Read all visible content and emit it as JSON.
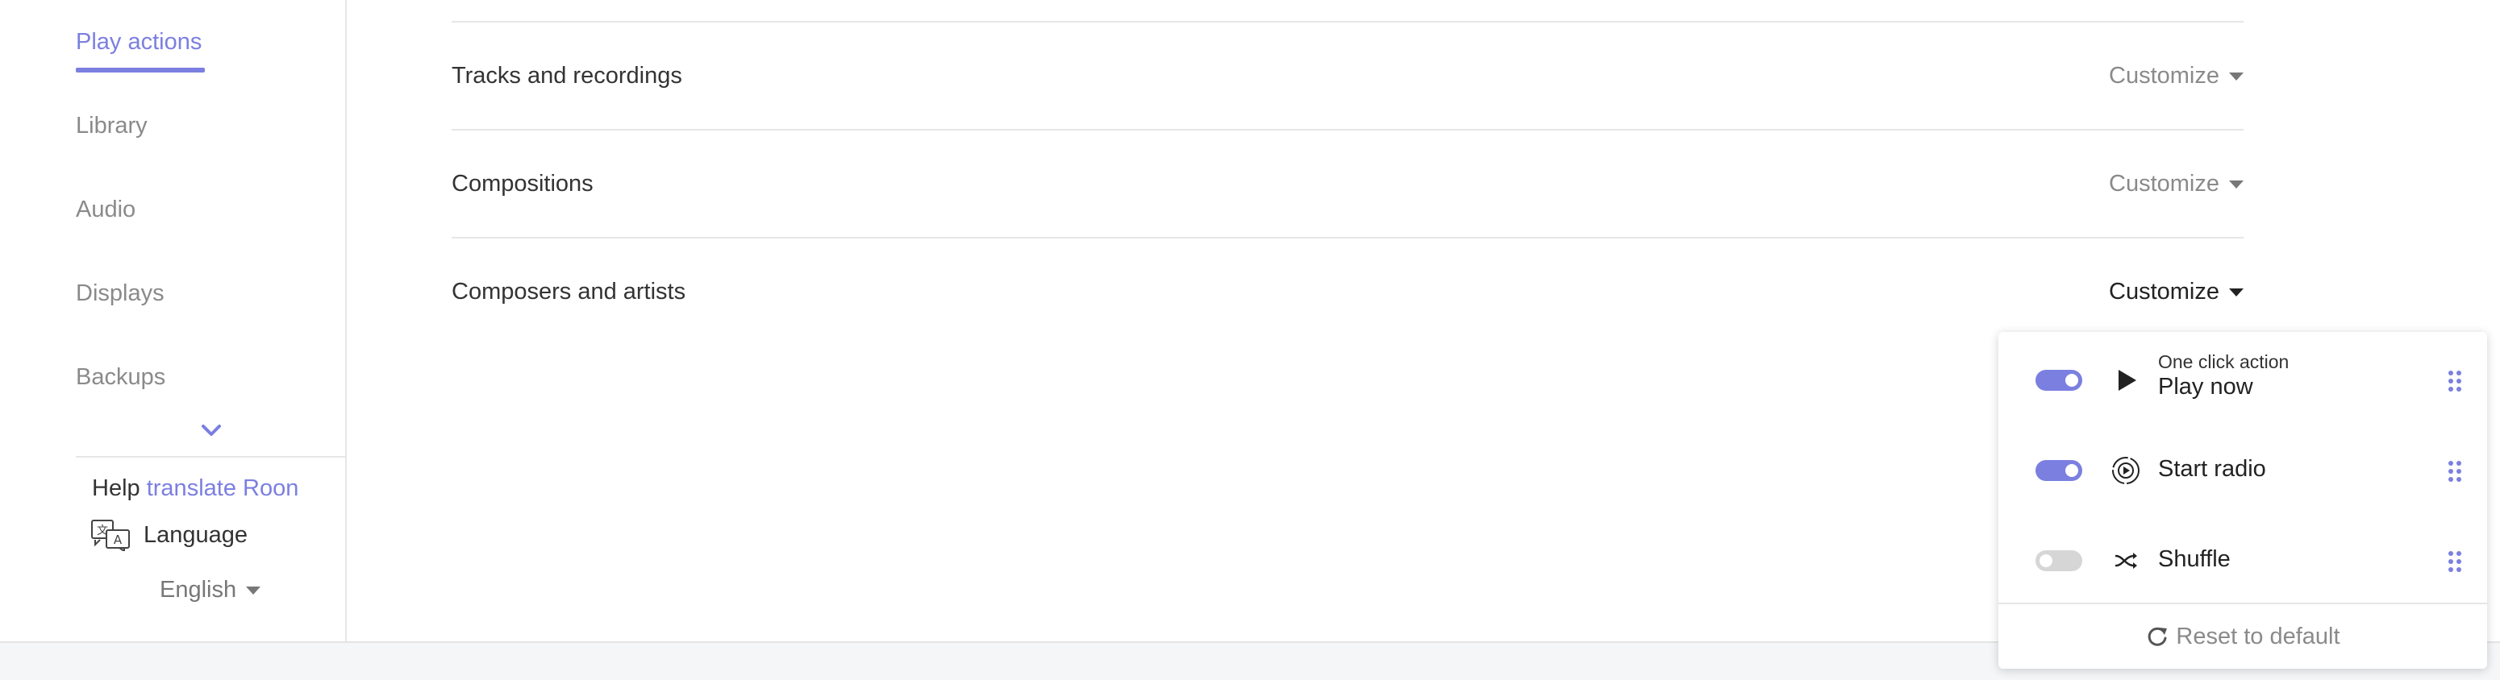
{
  "sidebar": {
    "items": [
      {
        "label": "Play actions",
        "active": true
      },
      {
        "label": "Library"
      },
      {
        "label": "Audio"
      },
      {
        "label": "Displays"
      },
      {
        "label": "Backups"
      }
    ],
    "help_text": "Help",
    "help_link": "translate Roon",
    "language_label": "Language",
    "language_value": "English"
  },
  "main": {
    "rows": [
      {
        "label": "Tracks and recordings",
        "action": "Customize"
      },
      {
        "label": "Compositions",
        "action": "Customize"
      },
      {
        "label": "Composers and artists",
        "action": "Customize",
        "open": true
      }
    ]
  },
  "dropdown": {
    "items": [
      {
        "sub": "One click action",
        "label": "Play now",
        "icon": "play-icon",
        "enabled": true
      },
      {
        "label": "Start radio",
        "icon": "radio-icon",
        "enabled": true
      },
      {
        "label": "Shuffle",
        "icon": "shuffle-icon",
        "enabled": false
      }
    ],
    "reset_label": "Reset to default"
  },
  "colors": {
    "accent": "#7b7fe0",
    "toggle_off": "#d6d6d6",
    "footer_bg": "#f5f6f8"
  }
}
